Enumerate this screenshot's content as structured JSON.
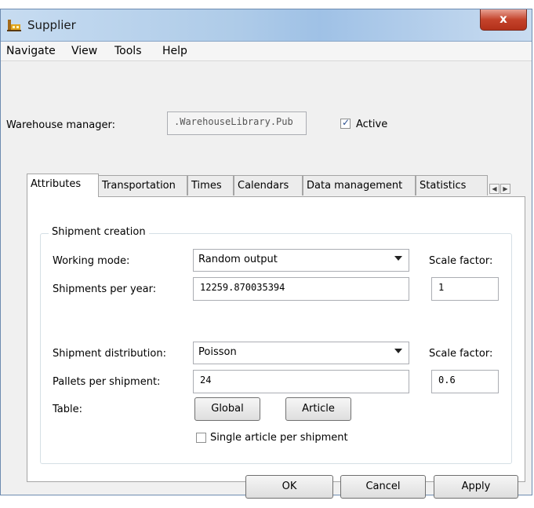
{
  "window": {
    "title": "Supplier",
    "icon": "supplier-app-icon",
    "close_label": "x"
  },
  "menu": {
    "items": [
      "Navigate",
      "View",
      "Tools",
      "Help"
    ]
  },
  "warehouse": {
    "label": "Warehouse manager:",
    "value": ".WarehouseLibrary.Pub",
    "active_label": "Active",
    "active_checked": true
  },
  "tabs": {
    "items": [
      "Attributes",
      "Transportation",
      "Times",
      "Calendars",
      "Data management",
      "Statistics"
    ],
    "active": "Attributes",
    "scroll_left_icon": "scroll-left-icon",
    "scroll_right_icon": "scroll-right-icon"
  },
  "shipment": {
    "group_title": "Shipment creation",
    "working_mode_label": "Working mode:",
    "working_mode_value": "Random output",
    "scale_factor_label": "Scale factor:",
    "shipments_per_year_label": "Shipments per year:",
    "shipments_per_year_value": "12259.870035394",
    "scale_factor_1": "1",
    "distribution_label": "Shipment distribution:",
    "distribution_value": "Poisson",
    "scale_factor_label_2": "Scale factor:",
    "pallets_label": "Pallets per shipment:",
    "pallets_value": "24",
    "scale_factor_2": "0.6",
    "table_label": "Table:",
    "global_button": "Global",
    "article_button": "Article",
    "single_article_label": "Single article per shipment",
    "single_article_checked": false
  },
  "footer": {
    "ok": "OK",
    "cancel": "Cancel",
    "apply": "Apply"
  },
  "colors": {
    "title_gradient": "#aecbe8",
    "close_button": "#c4432b",
    "checkbox_mark": "#2a4f8f"
  }
}
